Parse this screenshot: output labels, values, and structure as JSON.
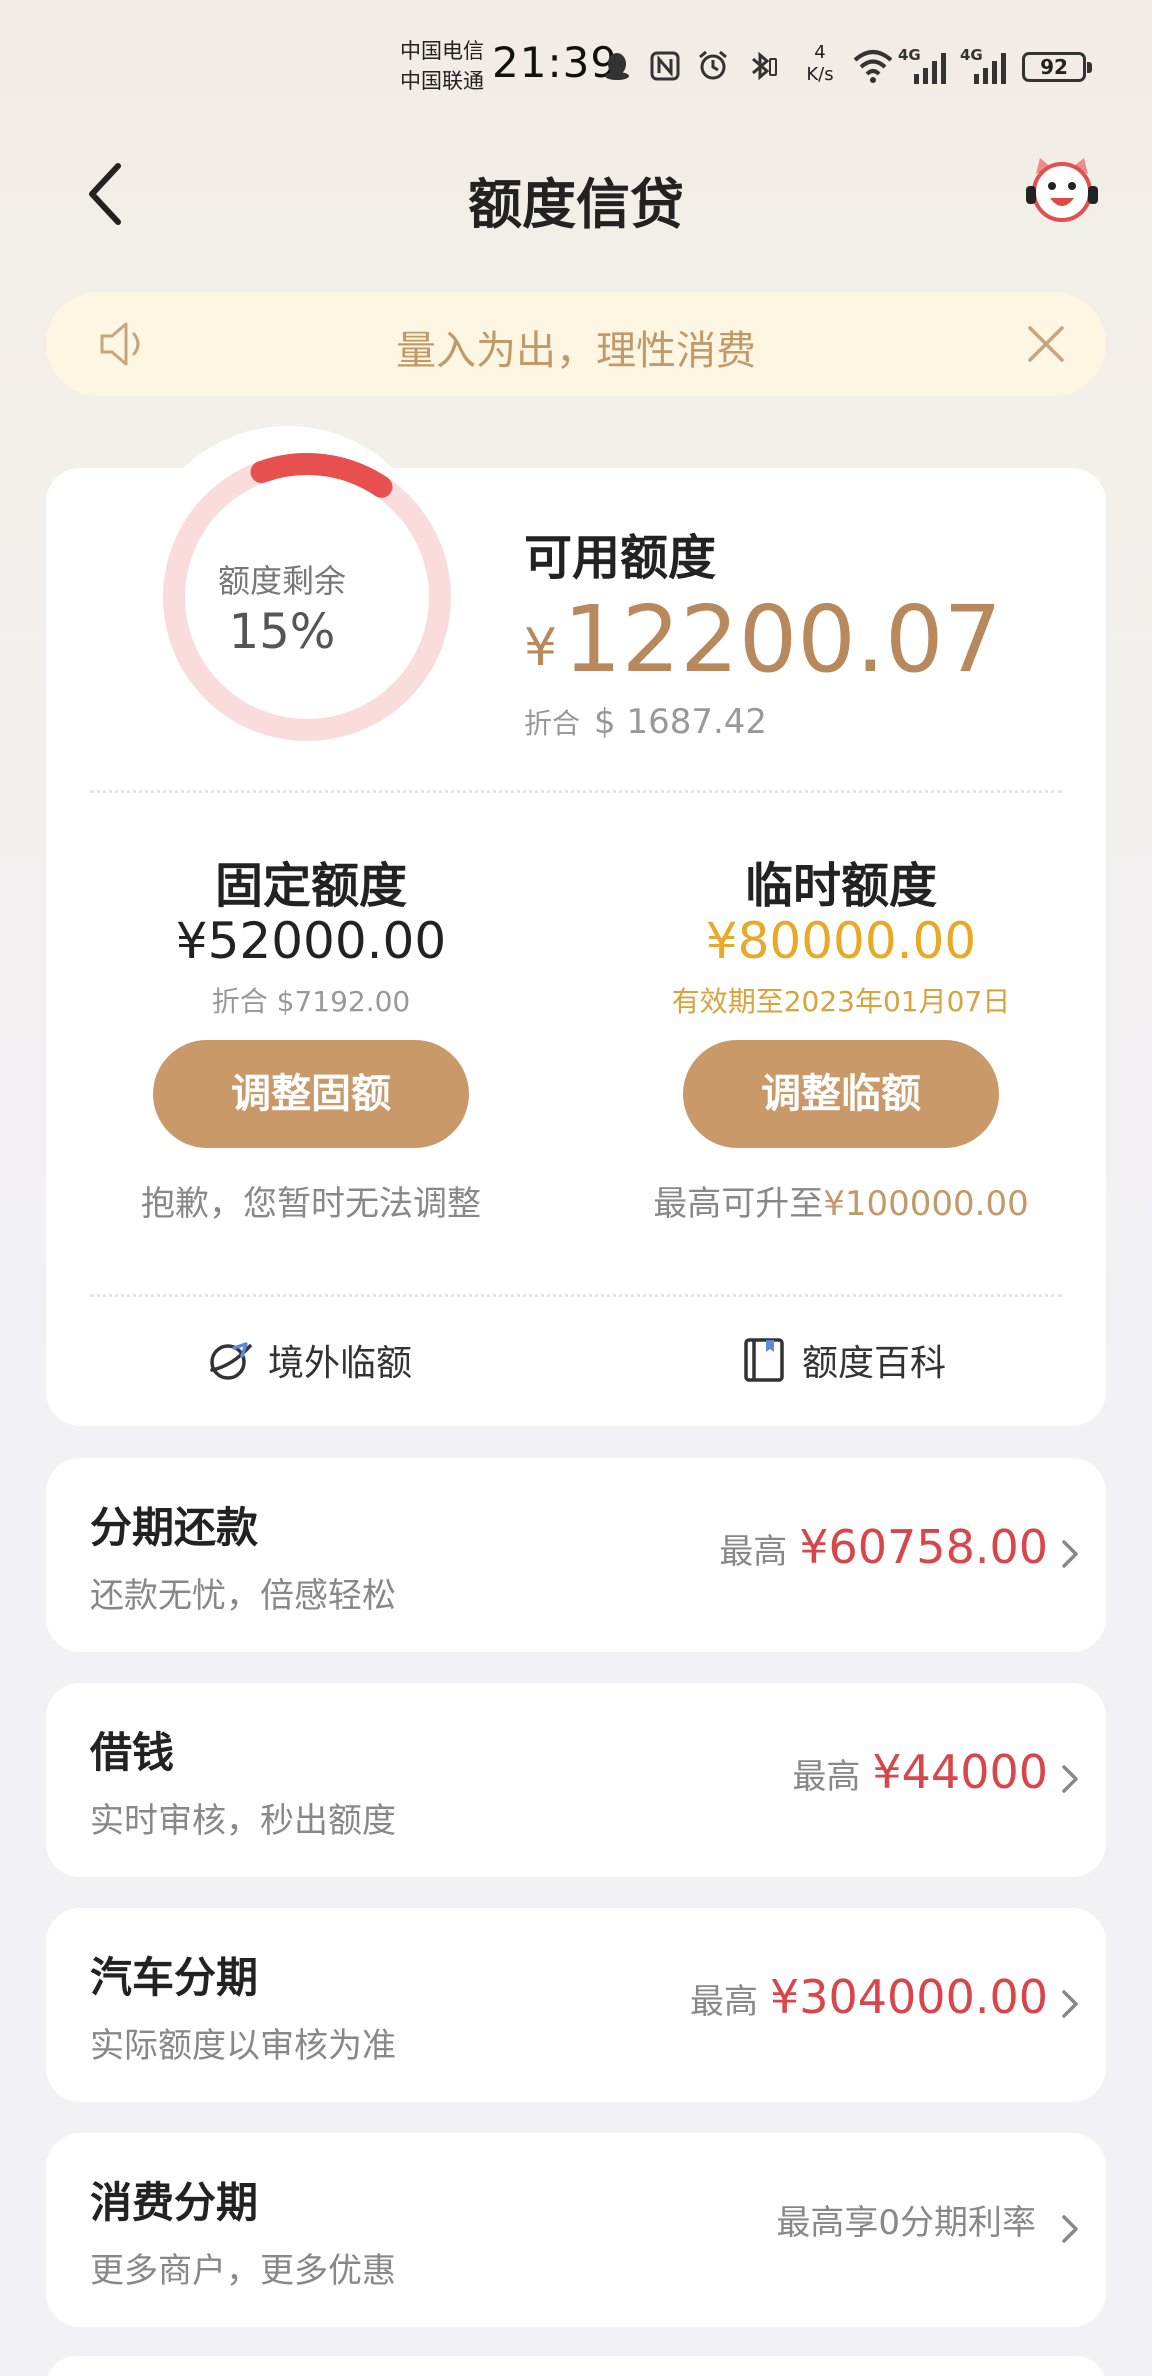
{
  "status": {
    "carrier1": "中国电信",
    "carrier2": "中国联通",
    "time": "21:39",
    "speed_value": "4",
    "speed_unit": "K/s",
    "net1": "4G",
    "net2": "4G",
    "battery": "92"
  },
  "header": {
    "title": "额度信贷"
  },
  "notice": {
    "text": "量入为出，理性消费"
  },
  "credit": {
    "ring_label": "额度剩余",
    "ring_value": "15%",
    "ring_fraction": 0.15,
    "available_title": "可用额度",
    "available_currency": "¥",
    "available_amount": "12200.07",
    "available_sub_label": "折合",
    "available_sub_value": "$ 1687.42",
    "fixed": {
      "title": "固定额度",
      "amount": "¥52000.00",
      "sub": "折合 $7192.00",
      "button": "调整固额",
      "note": "抱歉，您暂时无法调整"
    },
    "temporary": {
      "title": "临时额度",
      "amount": "¥80000.00",
      "sub": "有效期至2023年01月07日",
      "button": "调整临额",
      "note_prefix": "最高可升至",
      "note_value": "¥100000.00"
    },
    "links": {
      "overseas": "境外临额",
      "wiki": "额度百科"
    }
  },
  "loans": [
    {
      "title": "分期还款",
      "sub": "还款无忧，倍感轻松",
      "pre": "最高",
      "amount": "¥60758.00"
    },
    {
      "title": "借钱",
      "sub": "实时审核，秒出额度",
      "pre": "最高",
      "amount": "¥44000"
    },
    {
      "title": "汽车分期",
      "sub": "实际额度以审核为准",
      "pre": "最高",
      "amount": "¥304000.00"
    },
    {
      "title": "消费分期",
      "sub": "更多商户，更多优惠",
      "pre": "最高享0分期利率",
      "amount": ""
    }
  ],
  "colors": {
    "accent_gold": "#c9996a",
    "temp_gold": "#e9a825",
    "price_red": "#d8454a",
    "ring_red": "#e8504f",
    "ring_track": "#fadcdc"
  }
}
